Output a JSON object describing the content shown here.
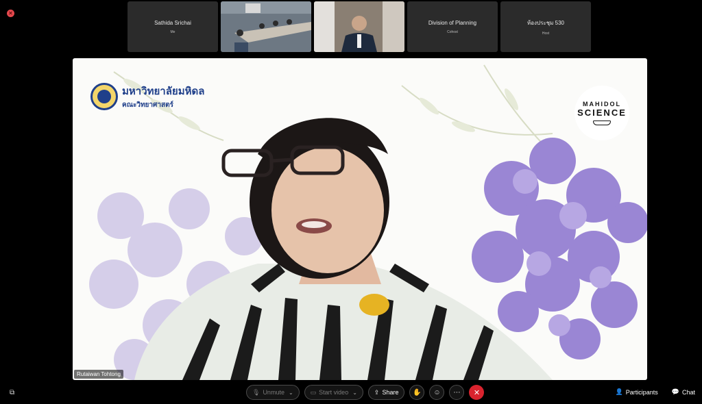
{
  "window": {
    "close_icon": "close-icon"
  },
  "participants_strip": [
    {
      "name": "Sathida Srichai",
      "sub": "Me",
      "type": "text"
    },
    {
      "name": "",
      "sub": "",
      "type": "video"
    },
    {
      "name": "",
      "sub": "",
      "type": "video"
    },
    {
      "name": "Division of Planning",
      "sub": "Cohost",
      "type": "text"
    },
    {
      "name": "ห้องประชุม 530",
      "sub": "Host",
      "type": "text"
    }
  ],
  "main_video": {
    "speaker_name": "Rutaiwan Tohtong",
    "logo_left_main": "มหาวิทยาลัยมหิดล",
    "logo_left_sub": "คณะวิทยาศาสตร์",
    "logo_right_line1": "MAHIDOL",
    "logo_right_line2": "SCIENCE"
  },
  "toolbar": {
    "unmute": "Unmute",
    "start_video": "Start video",
    "share": "Share",
    "participants": "Participants",
    "chat": "Chat"
  },
  "colors": {
    "end_call": "#d9232e",
    "brand_blue": "#1f3f8a"
  }
}
